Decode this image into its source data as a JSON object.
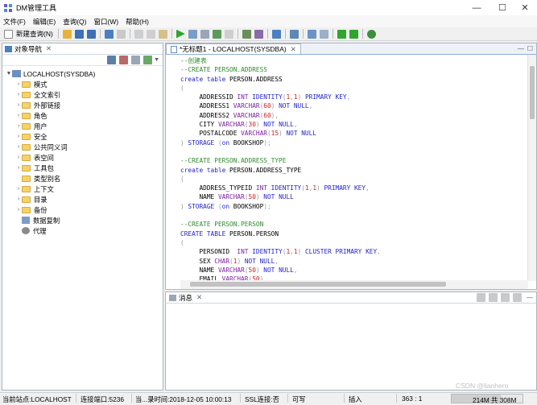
{
  "window": {
    "title": "DM管理工具",
    "minimize": "—",
    "maximize": "☐",
    "close": "✕"
  },
  "menu": [
    "文件(F)",
    "编辑(E)",
    "查询(Q)",
    "窗口(W)",
    "帮助(H)"
  ],
  "toolbar": {
    "new_query": "新建查询(N)"
  },
  "navigator": {
    "tab_label": "对象导航",
    "root": "LOCALHOST(SYSDBA)",
    "items": [
      "模式",
      "全文索引",
      "外部链接",
      "角色",
      "用户",
      "安全",
      "公共同义词",
      "表空间",
      "工具包",
      "类型别名",
      "上下文",
      "目录",
      "备份",
      "数据复制",
      "代理"
    ]
  },
  "editor": {
    "tab_label": "*无标题1 - LOCALHOST(SYSDBA)",
    "lines": [
      [
        {
          "t": "--创建表",
          "c": "cm"
        }
      ],
      [
        {
          "t": "--CREATE PERSON.ADDRESS",
          "c": "cm"
        }
      ],
      [
        {
          "t": "create table ",
          "c": "kw"
        },
        {
          "t": "PERSON.ADDRESS",
          "c": "id"
        }
      ],
      [
        {
          "t": "(",
          "c": "pn"
        }
      ],
      [
        {
          "t": "     ADDRESSID ",
          "c": "id"
        },
        {
          "t": "INT ",
          "c": "ty"
        },
        {
          "t": "IDENTITY",
          "c": "kw"
        },
        {
          "t": "(",
          "c": "pn"
        },
        {
          "t": "1",
          "c": "nm"
        },
        {
          "t": ",",
          "c": "pn"
        },
        {
          "t": "1",
          "c": "nm"
        },
        {
          "t": ") ",
          "c": "pn"
        },
        {
          "t": "PRIMARY KEY",
          "c": "kw"
        },
        {
          "t": ",",
          "c": "pn"
        }
      ],
      [
        {
          "t": "     ADDRESS1 ",
          "c": "id"
        },
        {
          "t": "VARCHAR",
          "c": "ty"
        },
        {
          "t": "(",
          "c": "pn"
        },
        {
          "t": "60",
          "c": "nm"
        },
        {
          "t": ") ",
          "c": "pn"
        },
        {
          "t": "NOT NULL",
          "c": "kw"
        },
        {
          "t": ",",
          "c": "pn"
        }
      ],
      [
        {
          "t": "     ADDRESS2 ",
          "c": "id"
        },
        {
          "t": "VARCHAR",
          "c": "ty"
        },
        {
          "t": "(",
          "c": "pn"
        },
        {
          "t": "60",
          "c": "nm"
        },
        {
          "t": "),",
          "c": "pn"
        }
      ],
      [
        {
          "t": "     CITY ",
          "c": "id"
        },
        {
          "t": "VARCHAR",
          "c": "ty"
        },
        {
          "t": "(",
          "c": "pn"
        },
        {
          "t": "30",
          "c": "nm"
        },
        {
          "t": ") ",
          "c": "pn"
        },
        {
          "t": "NOT NULL",
          "c": "kw"
        },
        {
          "t": ",",
          "c": "pn"
        }
      ],
      [
        {
          "t": "     POSTALCODE ",
          "c": "id"
        },
        {
          "t": "VARCHAR",
          "c": "ty"
        },
        {
          "t": "(",
          "c": "pn"
        },
        {
          "t": "15",
          "c": "nm"
        },
        {
          "t": ") ",
          "c": "pn"
        },
        {
          "t": "NOT NULL",
          "c": "kw"
        }
      ],
      [
        {
          "t": ") ",
          "c": "pn"
        },
        {
          "t": "STORAGE ",
          "c": "kw"
        },
        {
          "t": "(",
          "c": "pn"
        },
        {
          "t": "on ",
          "c": "kw"
        },
        {
          "t": "BOOKSHOP",
          "c": "id"
        },
        {
          "t": ");",
          "c": "pn"
        }
      ],
      [
        {
          "t": "",
          "c": "id"
        }
      ],
      [
        {
          "t": "--CREATE PERSON.ADDRESS_TYPE",
          "c": "cm"
        }
      ],
      [
        {
          "t": "create table ",
          "c": "kw"
        },
        {
          "t": "PERSON.ADDRESS_TYPE",
          "c": "id"
        }
      ],
      [
        {
          "t": "(",
          "c": "pn"
        }
      ],
      [
        {
          "t": "     ADDRESS_TYPEID ",
          "c": "id"
        },
        {
          "t": "INT ",
          "c": "ty"
        },
        {
          "t": "IDENTITY",
          "c": "kw"
        },
        {
          "t": "(",
          "c": "pn"
        },
        {
          "t": "1",
          "c": "nm"
        },
        {
          "t": ",",
          "c": "pn"
        },
        {
          "t": "1",
          "c": "nm"
        },
        {
          "t": ") ",
          "c": "pn"
        },
        {
          "t": "PRIMARY KEY",
          "c": "kw"
        },
        {
          "t": ",",
          "c": "pn"
        }
      ],
      [
        {
          "t": "     NAME ",
          "c": "id"
        },
        {
          "t": "VARCHAR",
          "c": "ty"
        },
        {
          "t": "(",
          "c": "pn"
        },
        {
          "t": "50",
          "c": "nm"
        },
        {
          "t": ") ",
          "c": "pn"
        },
        {
          "t": "NOT NULL",
          "c": "kw"
        }
      ],
      [
        {
          "t": ") ",
          "c": "pn"
        },
        {
          "t": "STORAGE ",
          "c": "kw"
        },
        {
          "t": "(",
          "c": "pn"
        },
        {
          "t": "on ",
          "c": "kw"
        },
        {
          "t": "BOOKSHOP",
          "c": "id"
        },
        {
          "t": ");",
          "c": "pn"
        }
      ],
      [
        {
          "t": "",
          "c": "id"
        }
      ],
      [
        {
          "t": "--CREATE PERSON.PERSON",
          "c": "cm"
        }
      ],
      [
        {
          "t": "CREATE TABLE ",
          "c": "kw"
        },
        {
          "t": "PERSON.PERSON",
          "c": "id"
        }
      ],
      [
        {
          "t": "(",
          "c": "pn"
        }
      ],
      [
        {
          "t": "     PERSONID  ",
          "c": "id"
        },
        {
          "t": "INT ",
          "c": "ty"
        },
        {
          "t": "IDENTITY",
          "c": "kw"
        },
        {
          "t": "(",
          "c": "pn"
        },
        {
          "t": "1",
          "c": "nm"
        },
        {
          "t": ",",
          "c": "pn"
        },
        {
          "t": "1",
          "c": "nm"
        },
        {
          "t": ") ",
          "c": "pn"
        },
        {
          "t": "CLUSTER PRIMARY KEY",
          "c": "kw"
        },
        {
          "t": ",",
          "c": "pn"
        }
      ],
      [
        {
          "t": "     SEX ",
          "c": "id"
        },
        {
          "t": "CHAR",
          "c": "ty"
        },
        {
          "t": "(",
          "c": "pn"
        },
        {
          "t": "1",
          "c": "nm"
        },
        {
          "t": ") ",
          "c": "pn"
        },
        {
          "t": "NOT NULL",
          "c": "kw"
        },
        {
          "t": ",",
          "c": "pn"
        }
      ],
      [
        {
          "t": "     NAME ",
          "c": "id"
        },
        {
          "t": "VARCHAR",
          "c": "ty"
        },
        {
          "t": "(",
          "c": "pn"
        },
        {
          "t": "50",
          "c": "nm"
        },
        {
          "t": ") ",
          "c": "pn"
        },
        {
          "t": "NOT NULL",
          "c": "kw"
        },
        {
          "t": ",",
          "c": "pn"
        }
      ],
      [
        {
          "t": "     EMAIL ",
          "c": "id"
        },
        {
          "t": "VARCHAR",
          "c": "ty"
        },
        {
          "t": "(",
          "c": "pn"
        },
        {
          "t": "50",
          "c": "nm"
        },
        {
          "t": ")",
          "c": "pn"
        }
      ]
    ]
  },
  "messages": {
    "tab_label": "消息"
  },
  "status": {
    "site": "当前站点:LOCALHOST",
    "port": "连接端口:5236",
    "login_time": "当...录时间:2018-12-05 10:00:13",
    "ssl": "SSL连接:否",
    "mode": "可写",
    "insert": "插入",
    "position": "363 : 1",
    "memory": "214M 共 308M",
    "memory_used_fraction": 0.69
  },
  "watermark": "CSDN @lianhero",
  "colors": {
    "comment": "#2e8b2e",
    "keyword": "#1f1fd0",
    "type": "#7a1fa2",
    "number": "#d02020"
  }
}
